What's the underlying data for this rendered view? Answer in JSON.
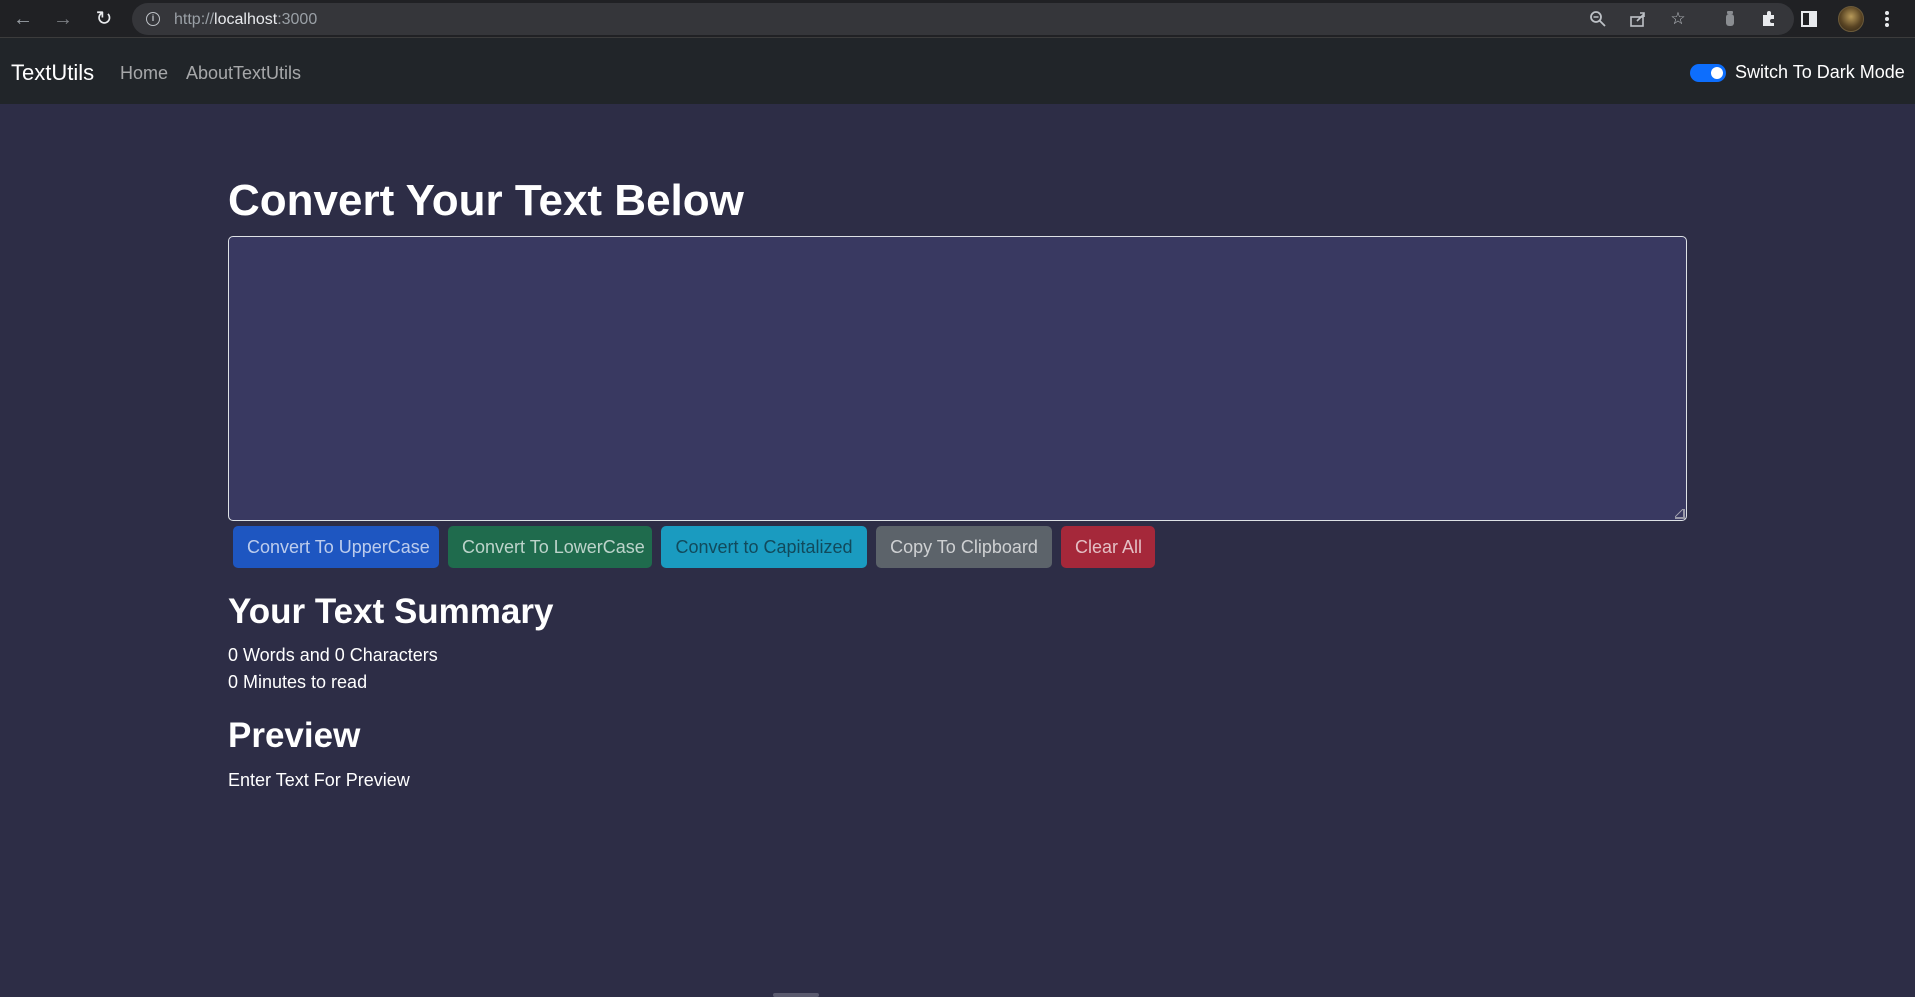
{
  "browser": {
    "url_scheme": "http://",
    "url_host": "localhost",
    "url_port": ":3000",
    "icons": [
      "back-icon",
      "forward-icon",
      "reload-icon",
      "info-icon",
      "zoom-icon",
      "share-icon",
      "bookmark-star-icon",
      "extension-puzzle-icon",
      "side-panel-icon",
      "profile-avatar",
      "menu-kebab-icon"
    ]
  },
  "navbar": {
    "brand": "TextUtils",
    "links": [
      "Home",
      "AboutTextUtils"
    ],
    "toggle_label": "Switch To Dark Mode",
    "toggle_on": true
  },
  "form": {
    "heading": "Convert Your Text Below",
    "textarea_value": "",
    "buttons": {
      "upper": "Convert To UpperCase",
      "lower": "Convert To LowerCase",
      "capitalize": "Convert to Capitalized",
      "copy": "Copy To Clipboard",
      "clear": "Clear All"
    }
  },
  "summary": {
    "title": "Your Text Summary",
    "words_chars": "0 Words and 0 Characters",
    "read_time": "0 Minutes to read"
  },
  "preview": {
    "title": "Preview",
    "text": "Enter Text For Preview"
  },
  "colors": {
    "page_bg": "#2d2d46",
    "textarea_bg": "#393961",
    "navbar_bg": "#212529",
    "primary": "#1e56c1",
    "success": "#1f6b4d",
    "info": "#1a9bc0",
    "secondary": "#5c636a",
    "danger": "#a5283a"
  }
}
